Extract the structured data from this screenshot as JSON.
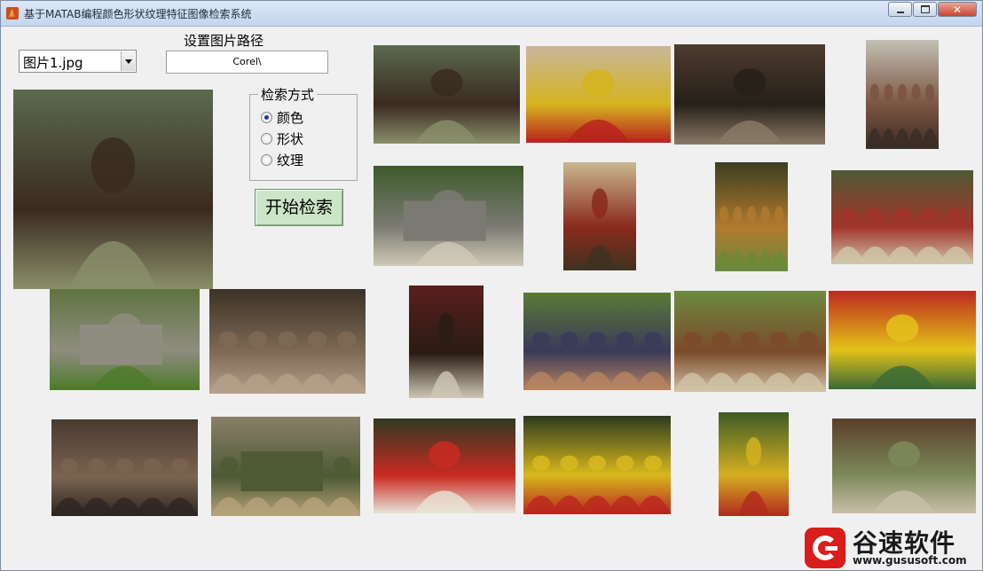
{
  "window": {
    "title": "基于MATAB编程颜色形状纹理特征图像检索系统",
    "controls": [
      "minimize-icon",
      "maximize-icon",
      "close-icon"
    ]
  },
  "image_select": {
    "selected": "图片1.jpg"
  },
  "path": {
    "label": "设置图片路径",
    "value": "Corel\\"
  },
  "search_method": {
    "legend": "检索方式",
    "options": [
      {
        "label": "颜色",
        "checked": true
      },
      {
        "label": "形状",
        "checked": false
      },
      {
        "label": "纹理",
        "checked": false
      }
    ]
  },
  "search_button": {
    "label": "开始检索"
  },
  "results": [
    {
      "subject": "woman-portrait",
      "colors": [
        "#5b6a4e",
        "#3a2a20",
        "#8a8f6a"
      ]
    },
    {
      "subject": "painted-face-feather-headdress",
      "colors": [
        "#c8b69a",
        "#d5b41f",
        "#b8201e"
      ]
    },
    {
      "subject": "bearded-man-hat",
      "colors": [
        "#4d3b30",
        "#262018",
        "#8a7a66"
      ]
    },
    {
      "subject": "old-man-seated",
      "colors": [
        "#c2c0b5",
        "#7a5440",
        "#3a2d25"
      ]
    },
    {
      "subject": "wooden-hut-in-jungle",
      "colors": [
        "#3d5a2a",
        "#7a7a72",
        "#cfc9b6"
      ]
    },
    {
      "subject": "two-warriors-red-paint",
      "colors": [
        "#c9b891",
        "#8a2a1c",
        "#3f3220"
      ]
    },
    {
      "subject": "festival-dancers",
      "colors": [
        "#3b3f21",
        "#b27a2e",
        "#6b8a3a"
      ]
    },
    {
      "subject": "market-crowd",
      "colors": [
        "#4e5a34",
        "#a0342a",
        "#cfc5a8"
      ]
    },
    {
      "subject": "stone-structure-grass",
      "colors": [
        "#5f7340",
        "#8f8d7f",
        "#4d7a2a"
      ]
    },
    {
      "subject": "seated-crowd",
      "colors": [
        "#3b3227",
        "#7e6a55",
        "#b7a08a"
      ]
    },
    {
      "subject": "old-man-white-beard",
      "colors": [
        "#5a1e1e",
        "#2a1c14",
        "#cfc7b5"
      ]
    },
    {
      "subject": "dance-line-field",
      "colors": [
        "#5b7a36",
        "#3a3a5a",
        "#b88460"
      ]
    },
    {
      "subject": "guitar-performers",
      "colors": [
        "#6d8a3e",
        "#7b4a2a",
        "#d0c3a5"
      ]
    },
    {
      "subject": "yellow-red-face-paint",
      "colors": [
        "#bc2920",
        "#e4c21a",
        "#3a6a34"
      ]
    },
    {
      "subject": "group-of-men",
      "colors": [
        "#4a3a30",
        "#7a6450",
        "#2e2620"
      ]
    },
    {
      "subject": "village-market-shed",
      "colors": [
        "#8a7f6a",
        "#4d5a34",
        "#b7a27a"
      ]
    },
    {
      "subject": "white-headdress-man",
      "colors": [
        "#2f3a22",
        "#c92a22",
        "#e8e3d6"
      ]
    },
    {
      "subject": "painted-face-crowd",
      "colors": [
        "#2d3a1f",
        "#d8b81e",
        "#b9281e"
      ]
    },
    {
      "subject": "dancer-portrait-green",
      "colors": [
        "#3f5a26",
        "#d4b020",
        "#b22a1e"
      ]
    },
    {
      "subject": "vegetables-on-ground",
      "colors": [
        "#5a3e2a",
        "#7d8a5a",
        "#c8bfa8"
      ]
    }
  ],
  "query_image": {
    "subject": "woman-portrait"
  },
  "watermark": {
    "name": "谷速软件",
    "url": "www.gususoft.com"
  }
}
